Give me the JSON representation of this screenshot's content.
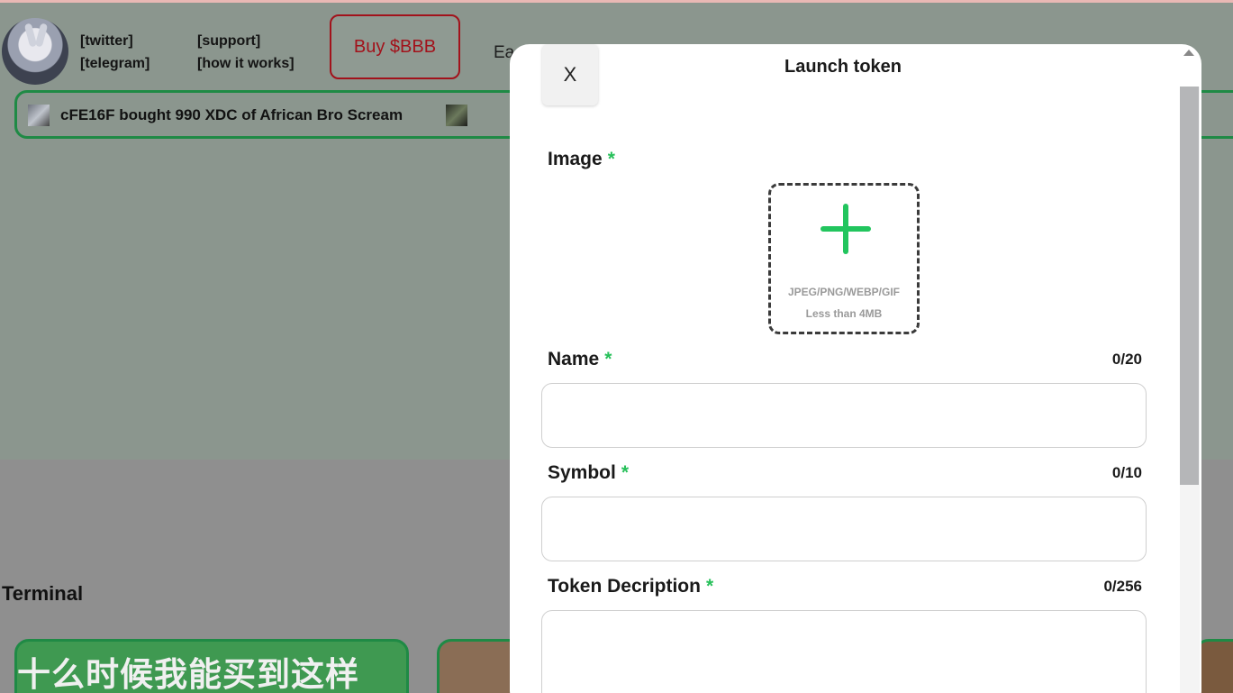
{
  "header": {
    "links": [
      "[twitter]",
      "[telegram]",
      "[support]",
      "[how it works]"
    ],
    "buy_button": "Buy $BBB",
    "truncated_text": "Ea"
  },
  "ticker": {
    "text": "cFE16F  bought 990 XDC of African Bro Scream"
  },
  "terminal": {
    "title": "Terminal",
    "card1_text": "十么时候我能买到这样"
  },
  "modal": {
    "title": "Launch token",
    "close_label": "X",
    "image_label": "Image",
    "required_mark": "*",
    "upload_formats": "JPEG/PNG/WEBP/GIF",
    "upload_size": "Less than 4MB",
    "name_label": "Name",
    "name_counter": "0/20",
    "name_value": "",
    "symbol_label": "Symbol",
    "symbol_counter": "0/10",
    "symbol_value": "",
    "desc_label": "Token Decription",
    "desc_counter": "0/256",
    "desc_value": ""
  },
  "colors": {
    "accent_green": "#22c55e",
    "buy_red": "#a2121b",
    "ticker_border": "#1f8a45"
  }
}
